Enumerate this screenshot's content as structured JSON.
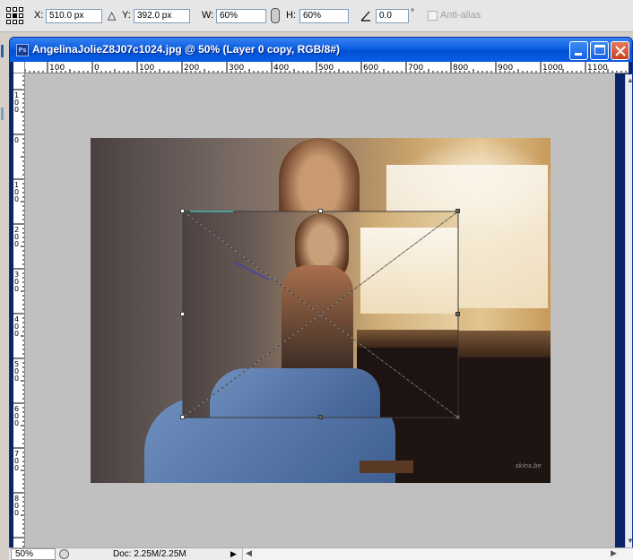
{
  "options_bar": {
    "x_label": "X:",
    "x_value": "510.0 px",
    "y_label": "Y:",
    "y_value": "392.0 px",
    "w_label": "W:",
    "w_value": "60%",
    "h_label": "H:",
    "h_value": "60%",
    "angle_value": "0.0",
    "degree_symbol": "°",
    "antialias_label": "Anti-alias",
    "antialias_checked": false
  },
  "document": {
    "title": "AngelinaJolieZ8J07c1024.jpg @ 50% (Layer 0 copy, RGB/8#)",
    "icon_label": "Ps"
  },
  "ruler": {
    "top_labels": [
      "100",
      "0",
      "100",
      "200",
      "300",
      "400",
      "500",
      "600",
      "700",
      "800",
      "900",
      "1000",
      "1100"
    ],
    "left_labels": [
      "100",
      "0",
      "100",
      "200",
      "300",
      "400",
      "500",
      "600",
      "700",
      "800"
    ]
  },
  "photo": {
    "watermark": "skins.be"
  },
  "status": {
    "zoom": "50%",
    "doc_info": "Doc: 2.25M/2.25M"
  },
  "colors": {
    "title_bar": "#0a5fe0",
    "close_button": "#c7401c",
    "canvas_background": "#c0c0c0"
  },
  "icons": [
    "reference-point-icon",
    "delta-icon",
    "link-icon",
    "angle-icon",
    "photoshop-icon",
    "minimize-icon",
    "maximize-icon",
    "close-icon",
    "play-icon",
    "status-icon"
  ]
}
